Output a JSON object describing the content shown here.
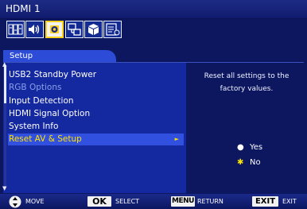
{
  "window": {
    "title": "HDMI 1"
  },
  "tabs": [
    {
      "name": "picture",
      "icon": "rgb-picture-icon",
      "active": false
    },
    {
      "name": "audio",
      "icon": "speaker-icon",
      "active": false
    },
    {
      "name": "setup",
      "icon": "gear-icon",
      "active": true
    },
    {
      "name": "network",
      "icon": "network-icon",
      "active": false
    },
    {
      "name": "pip",
      "icon": "cube-icon",
      "active": false
    },
    {
      "name": "info",
      "icon": "info-list-icon",
      "active": false
    }
  ],
  "panel": {
    "title": "Setup"
  },
  "menu": {
    "items": [
      {
        "label": "USB2 Standby Power",
        "state": "normal"
      },
      {
        "label": "RGB Options",
        "state": "disabled"
      },
      {
        "label": "Input Detection",
        "state": "normal"
      },
      {
        "label": "HDMI Signal Option",
        "state": "normal"
      },
      {
        "label": "System Info",
        "state": "normal"
      },
      {
        "label": "Reset AV & Setup",
        "state": "selected",
        "arrow": "►"
      }
    ]
  },
  "description": "Reset all settings to the factory values.",
  "options": [
    {
      "label": "Yes",
      "mark": "●",
      "selected": false
    },
    {
      "label": "No",
      "mark": "✱",
      "selected": true
    }
  ],
  "footer": {
    "move_label": "MOVE",
    "ok_key": "OK",
    "ok_label": "SELECT",
    "menu_key": "MENU",
    "menu_label": "RETURN",
    "exit_key": "EXIT",
    "exit_label": "EXIT"
  },
  "colors": {
    "background": "#0c1760",
    "menu_panel": "#1428a0",
    "highlight": "#3250e0",
    "selected_text": "#ffe400",
    "active_tab_border": "#ffd21a"
  }
}
